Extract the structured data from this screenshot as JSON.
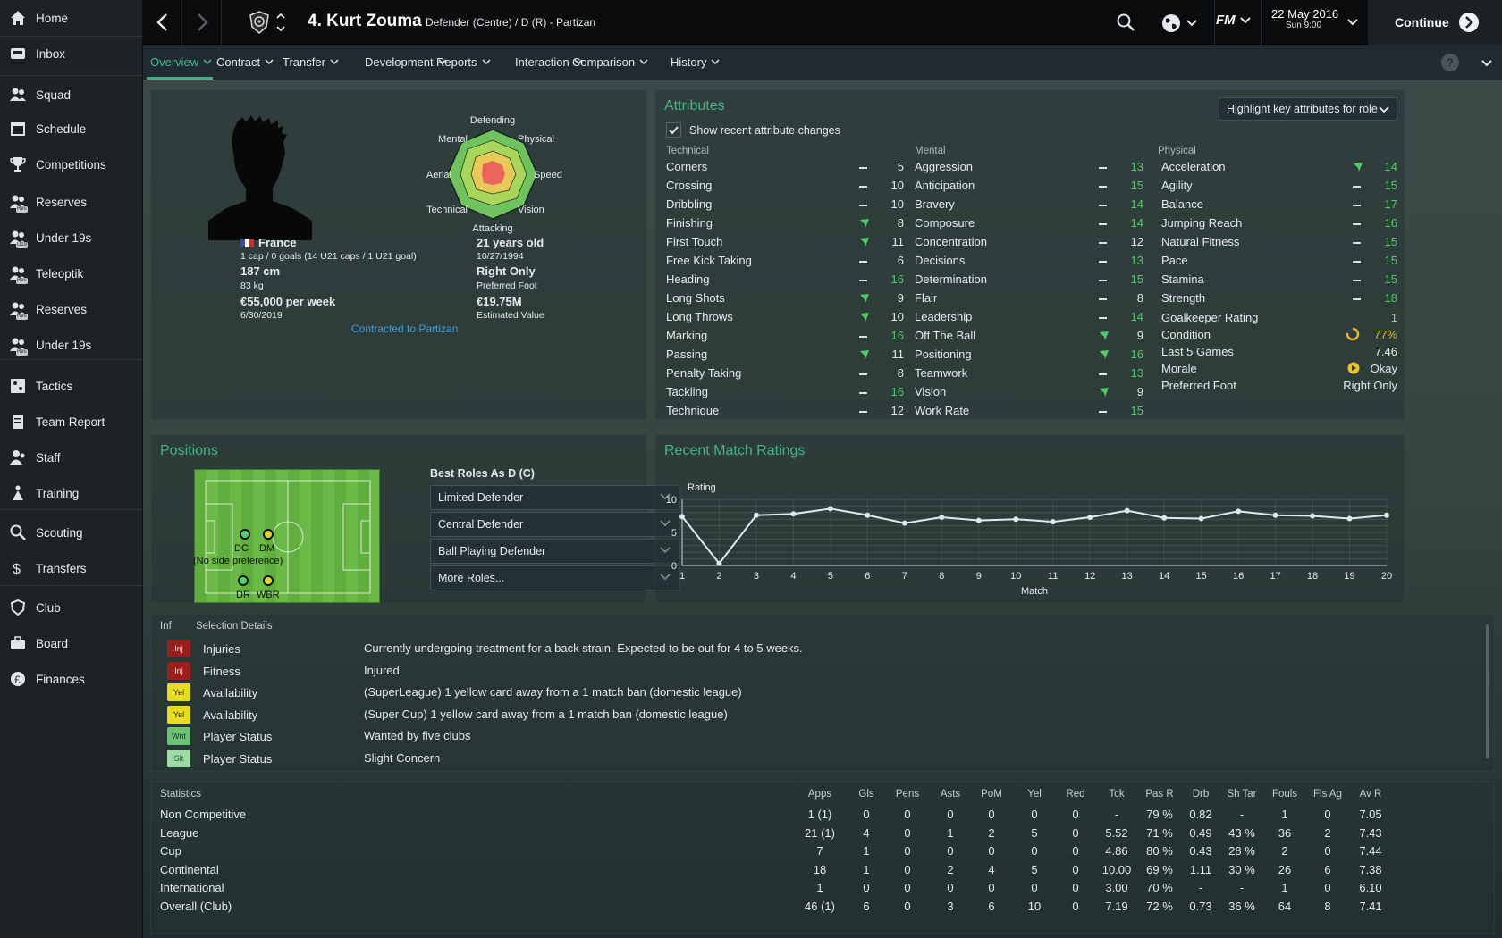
{
  "sidebar": {
    "items": [
      {
        "label": "Home",
        "icon": "home-icon"
      },
      {
        "label": "Inbox",
        "icon": "inbox-icon"
      },
      {
        "label": "Squad",
        "icon": "squad-icon"
      },
      {
        "label": "Schedule",
        "icon": "calendar-icon"
      },
      {
        "label": "Competitions",
        "icon": "trophy-icon"
      },
      {
        "label": "Reserves",
        "icon": "reserves-icon",
        "badge": "Res"
      },
      {
        "label": "Under 19s",
        "icon": "under19-icon",
        "badge": "U19"
      },
      {
        "label": "Teleoptik",
        "icon": "teleoptik-icon",
        "badge": "Res"
      },
      {
        "label": "Reserves",
        "icon": "reserves-icon",
        "badge": "Res"
      },
      {
        "label": "Under 19s",
        "icon": "under19-icon",
        "badge": "Res"
      },
      {
        "label": "Tactics",
        "icon": "tactics-icon"
      },
      {
        "label": "Team Report",
        "icon": "report-icon"
      },
      {
        "label": "Staff",
        "icon": "staff-icon"
      },
      {
        "label": "Training",
        "icon": "training-icon"
      },
      {
        "label": "Scouting",
        "icon": "search-icon"
      },
      {
        "label": "Transfers",
        "icon": "transfers-icon"
      },
      {
        "label": "Club",
        "icon": "club-icon"
      },
      {
        "label": "Board",
        "icon": "board-icon"
      },
      {
        "label": "Finances",
        "icon": "finances-icon"
      }
    ]
  },
  "header": {
    "player_name": "4. Kurt Zouma",
    "player_role": "Defender (Centre) / D (R) - Partizan",
    "date": "22 May 2016",
    "time": "Sun 9:00",
    "continue_label": "Continue",
    "fm_label": "FM"
  },
  "tabs": [
    "Overview",
    "Contract",
    "Transfer",
    "Development",
    "Reports",
    "Interaction",
    "Comparison",
    "History"
  ],
  "profile": {
    "nationality": "France",
    "caps": "1 cap / 0 goals (14 U21 caps / 1 U21 goal)",
    "height": "187 cm",
    "weight": "83 kg",
    "wage": "€55,000 per week",
    "contract_end": "6/30/2019",
    "age": "21 years old",
    "dob": "10/27/1994",
    "foot": "Right Only",
    "foot_label": "Preferred Foot",
    "value": "€19.75M",
    "value_label": "Estimated Value",
    "contract_link": "Contracted to Partizan"
  },
  "radar": {
    "labels": [
      "Defending",
      "Physical",
      "Speed",
      "Vision",
      "Attacking",
      "Technical",
      "Aerial",
      "Mental"
    ]
  },
  "attributes": {
    "title": "Attributes",
    "highlight_label": "Highlight key attributes for role",
    "show_changes_label": "Show recent attribute changes",
    "show_changes_checked": true,
    "technical_title": "Technical",
    "mental_title": "Mental",
    "physical_title": "Physical",
    "technical": [
      {
        "name": "Corners",
        "trend": "flat",
        "value": 5
      },
      {
        "name": "Crossing",
        "trend": "flat",
        "value": 10
      },
      {
        "name": "Dribbling",
        "trend": "flat",
        "value": 10
      },
      {
        "name": "Finishing",
        "trend": "up",
        "value": 8
      },
      {
        "name": "First Touch",
        "trend": "up",
        "value": 11
      },
      {
        "name": "Free Kick Taking",
        "trend": "flat",
        "value": 6
      },
      {
        "name": "Heading",
        "trend": "flat",
        "value": 16
      },
      {
        "name": "Long Shots",
        "trend": "up",
        "value": 9
      },
      {
        "name": "Long Throws",
        "trend": "up",
        "value": 10
      },
      {
        "name": "Marking",
        "trend": "flat",
        "value": 16
      },
      {
        "name": "Passing",
        "trend": "up",
        "value": 11
      },
      {
        "name": "Penalty Taking",
        "trend": "flat",
        "value": 8
      },
      {
        "name": "Tackling",
        "trend": "flat",
        "value": 16
      },
      {
        "name": "Technique",
        "trend": "flat",
        "value": 12
      }
    ],
    "mental": [
      {
        "name": "Aggression",
        "trend": "flat",
        "value": 13
      },
      {
        "name": "Anticipation",
        "trend": "flat",
        "value": 15
      },
      {
        "name": "Bravery",
        "trend": "flat",
        "value": 14
      },
      {
        "name": "Composure",
        "trend": "flat",
        "value": 14
      },
      {
        "name": "Concentration",
        "trend": "flat",
        "value": 12
      },
      {
        "name": "Decisions",
        "trend": "flat",
        "value": 13
      },
      {
        "name": "Determination",
        "trend": "flat",
        "value": 15
      },
      {
        "name": "Flair",
        "trend": "flat",
        "value": 8
      },
      {
        "name": "Leadership",
        "trend": "flat",
        "value": 14
      },
      {
        "name": "Off The Ball",
        "trend": "up",
        "value": 9
      },
      {
        "name": "Positioning",
        "trend": "up",
        "value": 16
      },
      {
        "name": "Teamwork",
        "trend": "flat",
        "value": 13
      },
      {
        "name": "Vision",
        "trend": "up",
        "value": 9
      },
      {
        "name": "Work Rate",
        "trend": "flat",
        "value": 15
      }
    ],
    "physical": [
      {
        "name": "Acceleration",
        "trend": "up",
        "value": 14
      },
      {
        "name": "Agility",
        "trend": "flat",
        "value": 15
      },
      {
        "name": "Balance",
        "trend": "flat",
        "value": 17
      },
      {
        "name": "Jumping Reach",
        "trend": "flat",
        "value": 16
      },
      {
        "name": "Natural Fitness",
        "trend": "flat",
        "value": 15
      },
      {
        "name": "Pace",
        "trend": "flat",
        "value": 15
      },
      {
        "name": "Stamina",
        "trend": "flat",
        "value": 15
      },
      {
        "name": "Strength",
        "trend": "flat",
        "value": 18
      }
    ],
    "extra": {
      "gk_label": "Goalkeeper Rating",
      "gk_value": "1",
      "condition_label": "Condition",
      "condition_value": "77%",
      "condition_fraction": 0.77,
      "last5_label": "Last 5 Games",
      "last5_value": "7.46",
      "morale_label": "Morale",
      "morale_value": "Okay",
      "foot_label": "Preferred Foot",
      "foot_value": "Right Only"
    }
  },
  "positions": {
    "title": "Positions",
    "best_roles_title": "Best Roles As D (C)",
    "roles": [
      "Limited Defender",
      "Central Defender",
      "Ball Playing Defender",
      "More Roles..."
    ],
    "pitch": [
      {
        "label": "DC",
        "color": "#55d46a",
        "sub": "(No side preference)"
      },
      {
        "label": "DM",
        "color": "#e6d22a"
      },
      {
        "label": "DR",
        "color": "#55d46a"
      },
      {
        "label": "WBR",
        "color": "#e6d22a"
      }
    ]
  },
  "ratings": {
    "title": "Recent Match Ratings",
    "chart_data": {
      "type": "line",
      "ylabel": "Rating",
      "xlabel": "Match",
      "ylim": [
        0,
        10
      ],
      "yticks": [
        0,
        5,
        10
      ],
      "x": [
        1,
        2,
        3,
        4,
        5,
        6,
        7,
        8,
        9,
        10,
        11,
        12,
        13,
        14,
        15,
        16,
        17,
        18,
        19,
        20
      ],
      "values": [
        7.4,
        0.3,
        7.6,
        7.8,
        8.6,
        7.6,
        6.4,
        7.3,
        6.8,
        7.0,
        6.6,
        7.3,
        8.3,
        7.2,
        7.1,
        8.2,
        7.6,
        7.5,
        7.1,
        7.6
      ]
    }
  },
  "selection": {
    "head_inf": "Inf",
    "head_details": "Selection Details",
    "rows": [
      {
        "tag": "Inj",
        "tag_color": "#9b1e1e",
        "tag_text_color": "#f2d7d7",
        "type": "Injuries",
        "detail": "Currently undergoing treatment for a back strain. Expected to be out for 4 to 5 weeks."
      },
      {
        "tag": "Inj",
        "tag_color": "#9b1e1e",
        "tag_text_color": "#f2d7d7",
        "type": "Fitness",
        "detail": "Injured"
      },
      {
        "tag": "Yel",
        "tag_color": "#e8dc1f",
        "tag_text_color": "#2a2a10",
        "type": "Availability",
        "detail": "(SuperLeague) 1 yellow card away from a 1 match ban (domestic league)"
      },
      {
        "tag": "Yel",
        "tag_color": "#e8dc1f",
        "tag_text_color": "#2a2a10",
        "type": "Availability",
        "detail": "(Super Cup) 1 yellow card away from a 1 match ban (domestic league)"
      },
      {
        "tag": "Wnt",
        "tag_color": "#6cc07a",
        "tag_text_color": "#1e3a22",
        "type": "Player Status",
        "detail": "Wanted by five clubs"
      },
      {
        "tag": "Slt",
        "tag_color": "#9fd8a7",
        "tag_text_color": "#2a4a30",
        "type": "Player Status",
        "detail": "Slight Concern"
      }
    ]
  },
  "statistics": {
    "title": "Statistics",
    "columns": [
      "Apps",
      "Gls",
      "Pens",
      "Asts",
      "PoM",
      "Yel",
      "Red",
      "Tck",
      "Pas R",
      "Drb",
      "Sh Tar",
      "Fouls",
      "Fls Ag",
      "Av R"
    ],
    "rows": [
      {
        "name": "Non Competitive",
        "cells": [
          "1 (1)",
          "0",
          "0",
          "0",
          "0",
          "0",
          "0",
          "-",
          "79 %",
          "0.82",
          "-",
          "1",
          "0",
          "7.05"
        ]
      },
      {
        "name": "League",
        "cells": [
          "21 (1)",
          "4",
          "0",
          "1",
          "2",
          "5",
          "0",
          "5.52",
          "71 %",
          "0.49",
          "43 %",
          "36",
          "2",
          "7.43"
        ]
      },
      {
        "name": "Cup",
        "cells": [
          "7",
          "1",
          "0",
          "0",
          "0",
          "0",
          "0",
          "4.86",
          "80 %",
          "0.43",
          "28 %",
          "2",
          "0",
          "7.44"
        ]
      },
      {
        "name": "Continental",
        "cells": [
          "18",
          "1",
          "0",
          "2",
          "4",
          "5",
          "0",
          "10.00",
          "69 %",
          "1.11",
          "30 %",
          "26",
          "6",
          "7.38"
        ]
      },
      {
        "name": "International",
        "cells": [
          "1",
          "0",
          "0",
          "0",
          "0",
          "0",
          "0",
          "3.00",
          "70 %",
          "-",
          "-",
          "1",
          "0",
          "6.10"
        ]
      },
      {
        "name": "Overall (Club)",
        "cells": [
          "46 (1)",
          "6",
          "0",
          "3",
          "6",
          "10",
          "0",
          "7.19",
          "72 %",
          "0.73",
          "36 %",
          "64",
          "8",
          "7.41"
        ]
      }
    ]
  }
}
